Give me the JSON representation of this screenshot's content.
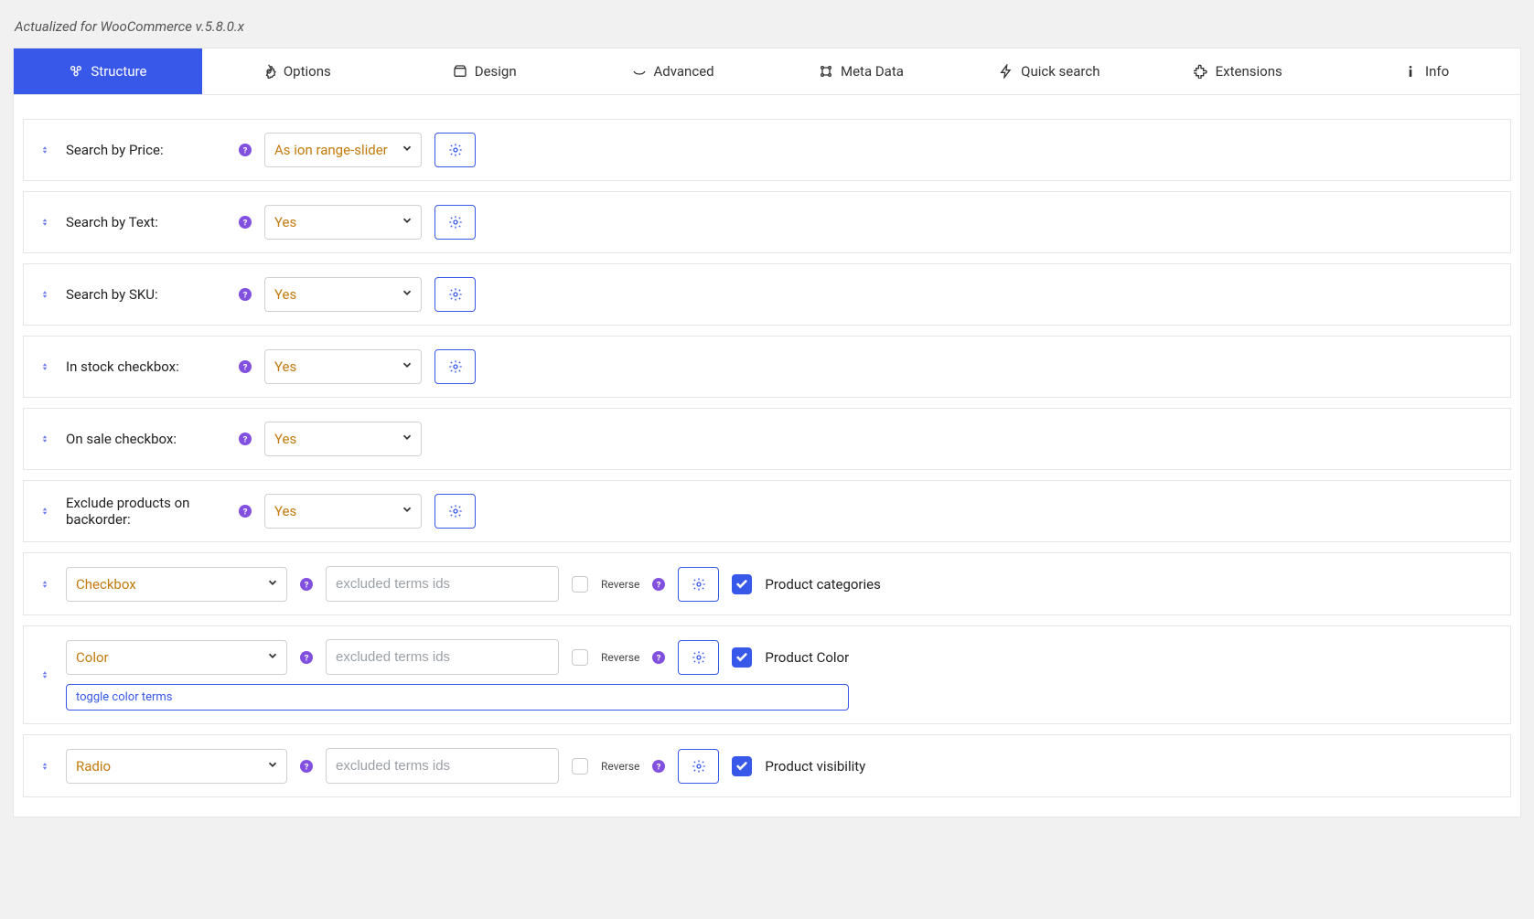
{
  "top_note": "Actualized for WooCommerce v.5.8.0.x",
  "tabs": [
    {
      "label": "Structure"
    },
    {
      "label": "Options"
    },
    {
      "label": "Design"
    },
    {
      "label": "Advanced"
    },
    {
      "label": "Meta Data"
    },
    {
      "label": "Quick search"
    },
    {
      "label": "Extensions"
    },
    {
      "label": "Info"
    }
  ],
  "rows": [
    {
      "label": "Search by Price:",
      "value": "As ion range-slider",
      "gear": true
    },
    {
      "label": "Search by Text:",
      "value": "Yes",
      "gear": true
    },
    {
      "label": "Search by SKU:",
      "value": "Yes",
      "gear": true
    },
    {
      "label": "In stock checkbox:",
      "value": "Yes",
      "gear": true
    },
    {
      "label": "On sale checkbox:",
      "value": "Yes",
      "gear": false
    },
    {
      "label": "Exclude products on backorder:",
      "value": "Yes",
      "gear": true
    }
  ],
  "excluded_placeholder": "excluded terms ids",
  "reverse_label": "Reverse",
  "filter_rows": [
    {
      "type": "Checkbox",
      "name": "Product categories",
      "checked": true
    },
    {
      "type": "Color",
      "name": "Product Color",
      "checked": true,
      "toggle": "toggle color terms"
    },
    {
      "type": "Radio",
      "name": "Product visibility",
      "checked": true
    }
  ]
}
